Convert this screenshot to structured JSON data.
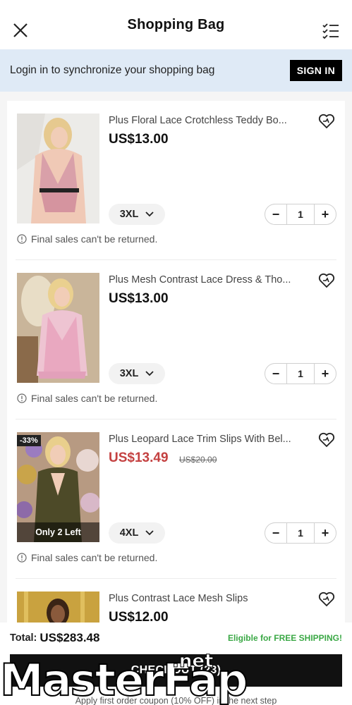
{
  "header": {
    "title": "Shopping Bag"
  },
  "banner": {
    "message": "Login in to synchronize your shopping bag",
    "signin_label": "SIGN IN"
  },
  "items": [
    {
      "name": "Plus Floral Lace Crotchless Teddy Bo...",
      "price": "US$13.00",
      "size": "3XL",
      "qty": "1",
      "note": "Final sales can't be returned."
    },
    {
      "name": "Plus Mesh Contrast Lace Dress & Tho...",
      "price": "US$13.00",
      "size": "3XL",
      "qty": "1",
      "note": "Final sales can't be returned."
    },
    {
      "name": "Plus Leopard Lace Trim Slips With Bel...",
      "price": "US$13.49",
      "original_price": "US$20.00",
      "discount": "-33%",
      "stock": "Only 2 Left",
      "size": "4XL",
      "qty": "1",
      "note": "Final sales can't be returned."
    },
    {
      "name": "Plus Contrast Lace Mesh Slips",
      "price": "US$12.00"
    }
  ],
  "footer": {
    "total_label": "Total:",
    "total_value": "US$283.48",
    "shipping": "Eligible for FREE SHIPPING!",
    "checkout_label": "CHECKOUT (23)",
    "coupon": "Apply first order coupon (10% OFF) in the next step"
  },
  "watermark": {
    "text1": "MasterFap",
    "text2": ".net"
  },
  "colors": {
    "banner_bg": "#dfeaf6",
    "sale_price": "#c44141",
    "shipping_green": "#3aa845",
    "checkout_bg": "#111111"
  }
}
